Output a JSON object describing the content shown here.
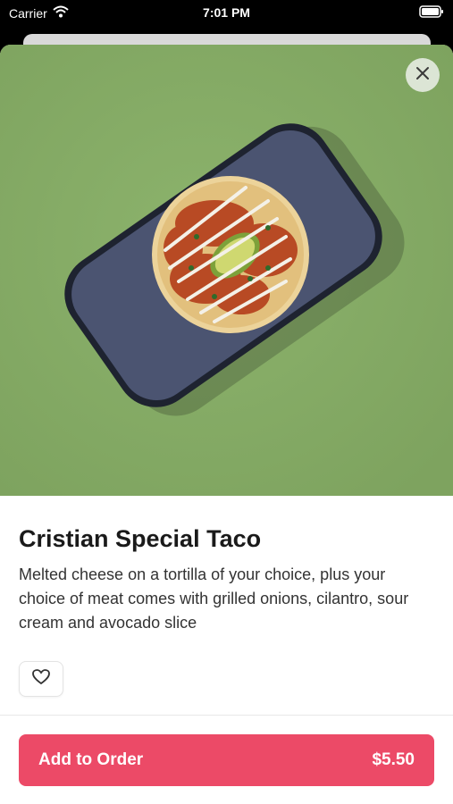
{
  "status_bar": {
    "carrier": "Carrier",
    "time": "7:01 PM"
  },
  "product": {
    "name": "Cristian Special Taco",
    "description": "Melted cheese on a tortilla of your choice, plus your choice of meat comes with grilled onions, cilantro, sour cream and avocado slice",
    "price": "$5.50"
  },
  "actions": {
    "add_label": "Add to Order"
  },
  "icons": {
    "close": "close-icon",
    "favorite": "heart-icon",
    "wifi": "wifi-icon",
    "battery": "battery-icon"
  },
  "colors": {
    "accent": "#ec4a67",
    "hero_background": "#86ad66"
  }
}
